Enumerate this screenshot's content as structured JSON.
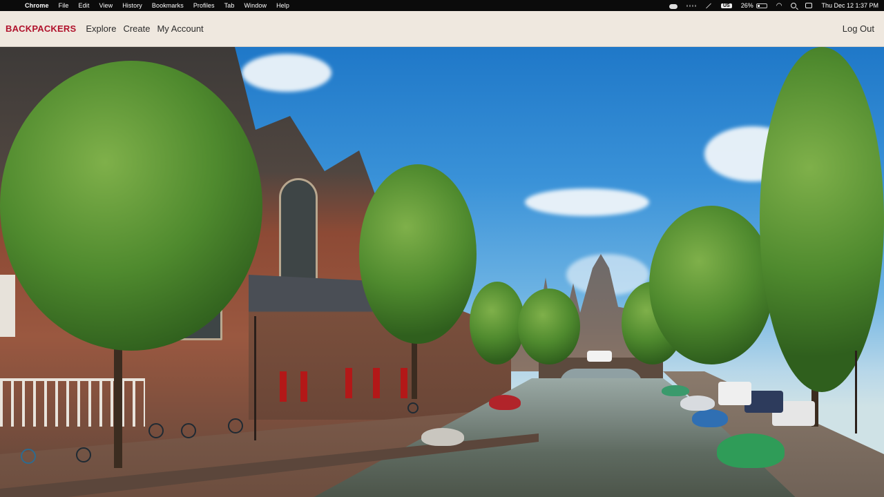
{
  "menubar": {
    "apple": "",
    "items": [
      "Chrome",
      "File",
      "Edit",
      "View",
      "History",
      "Bookmarks",
      "Profiles",
      "Tab",
      "Window",
      "Help"
    ],
    "keyboard": "US",
    "battery_percent": "26%",
    "battery_level": 0.26,
    "datetime": "Thu Dec 12  1:37 PM"
  },
  "nav": {
    "brand": "BACKPACKERS",
    "links": [
      "Explore",
      "Create",
      "My Account"
    ],
    "logout": "Log Out",
    "brand_color": "#b0112b",
    "bar_color": "#efe8df"
  },
  "hero": {
    "icon": "canal-city-photo"
  }
}
